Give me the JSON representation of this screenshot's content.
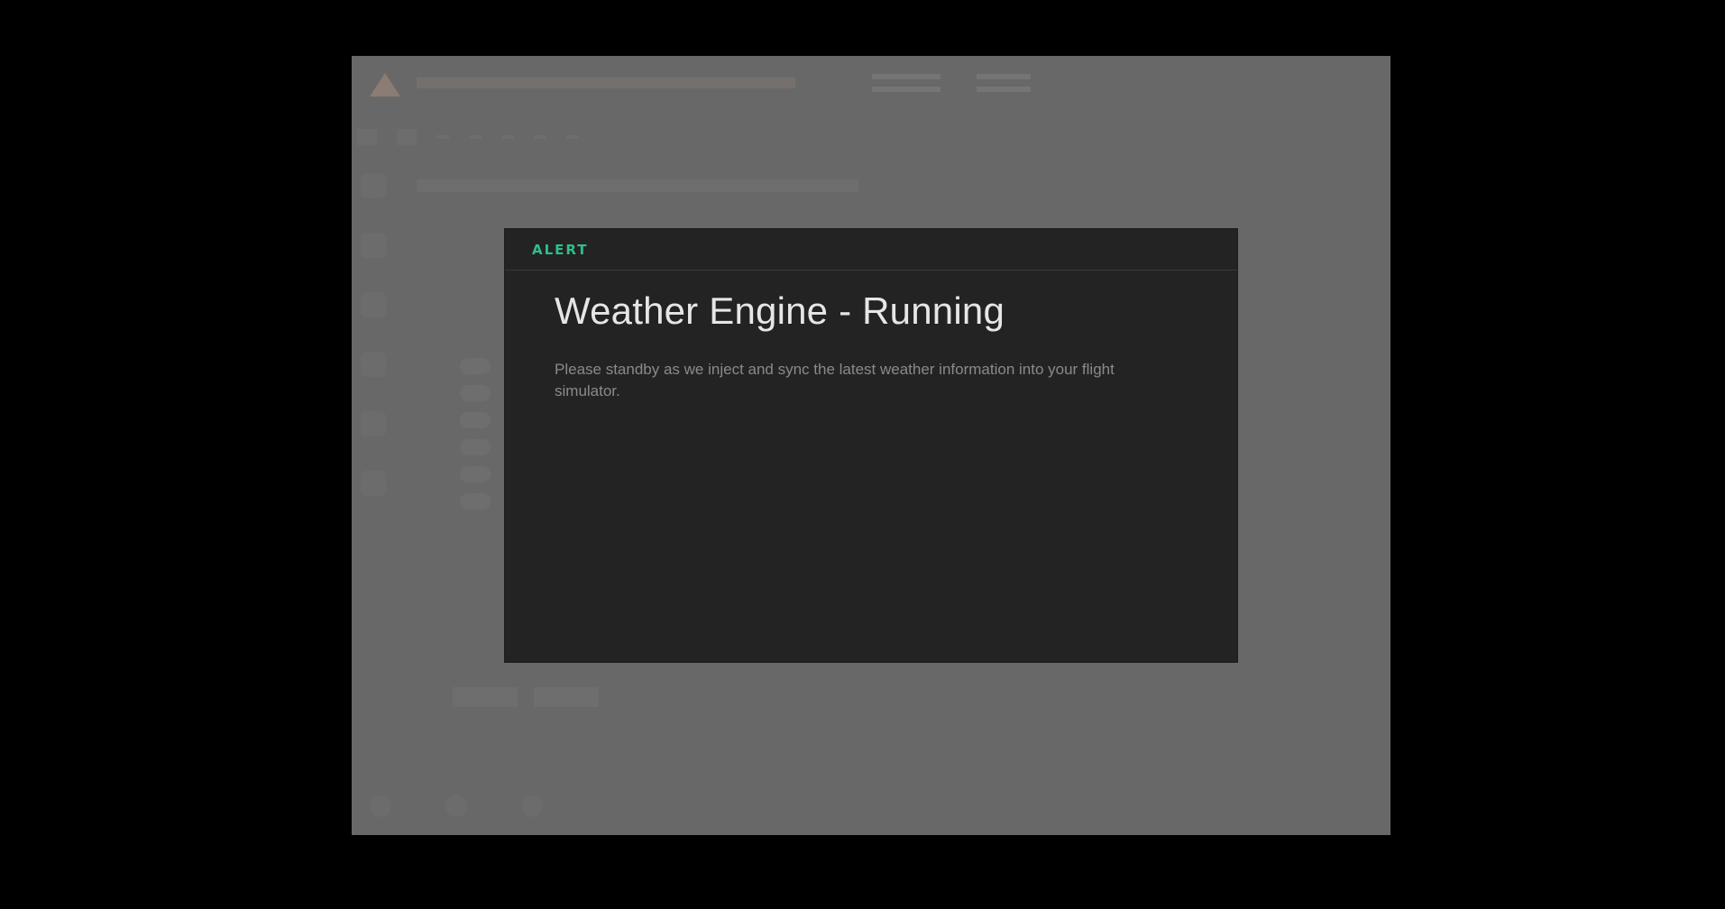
{
  "modal": {
    "tag": "ALERT",
    "title": "Weather Engine - Running",
    "message": "Please standby as we inject and sync the latest weather information into your flight simulator."
  },
  "colors": {
    "accent": "#2fbf8a",
    "modal_background": "#232323",
    "overlay": "#8c8c8c",
    "screen_background": "#000000"
  }
}
